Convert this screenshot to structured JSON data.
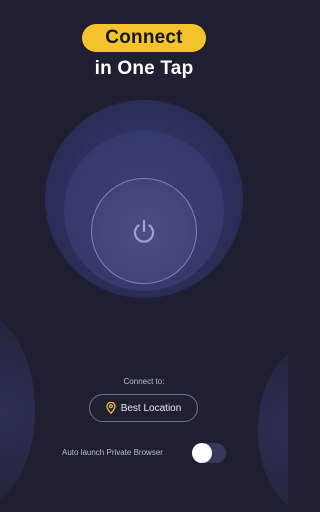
{
  "headline": {
    "pill_text": "Connect",
    "subtitle": "in One Tap"
  },
  "connect_button": {
    "icon": "power-icon"
  },
  "location": {
    "label": "Connect to:",
    "value": "Best Location",
    "icon": "location-pin-icon"
  },
  "auto_launch": {
    "label": "Auto launch Private Browser",
    "enabled": false
  },
  "colors": {
    "background": "#1e2032",
    "accent": "#f4c32b",
    "ring": "#353a6c"
  }
}
